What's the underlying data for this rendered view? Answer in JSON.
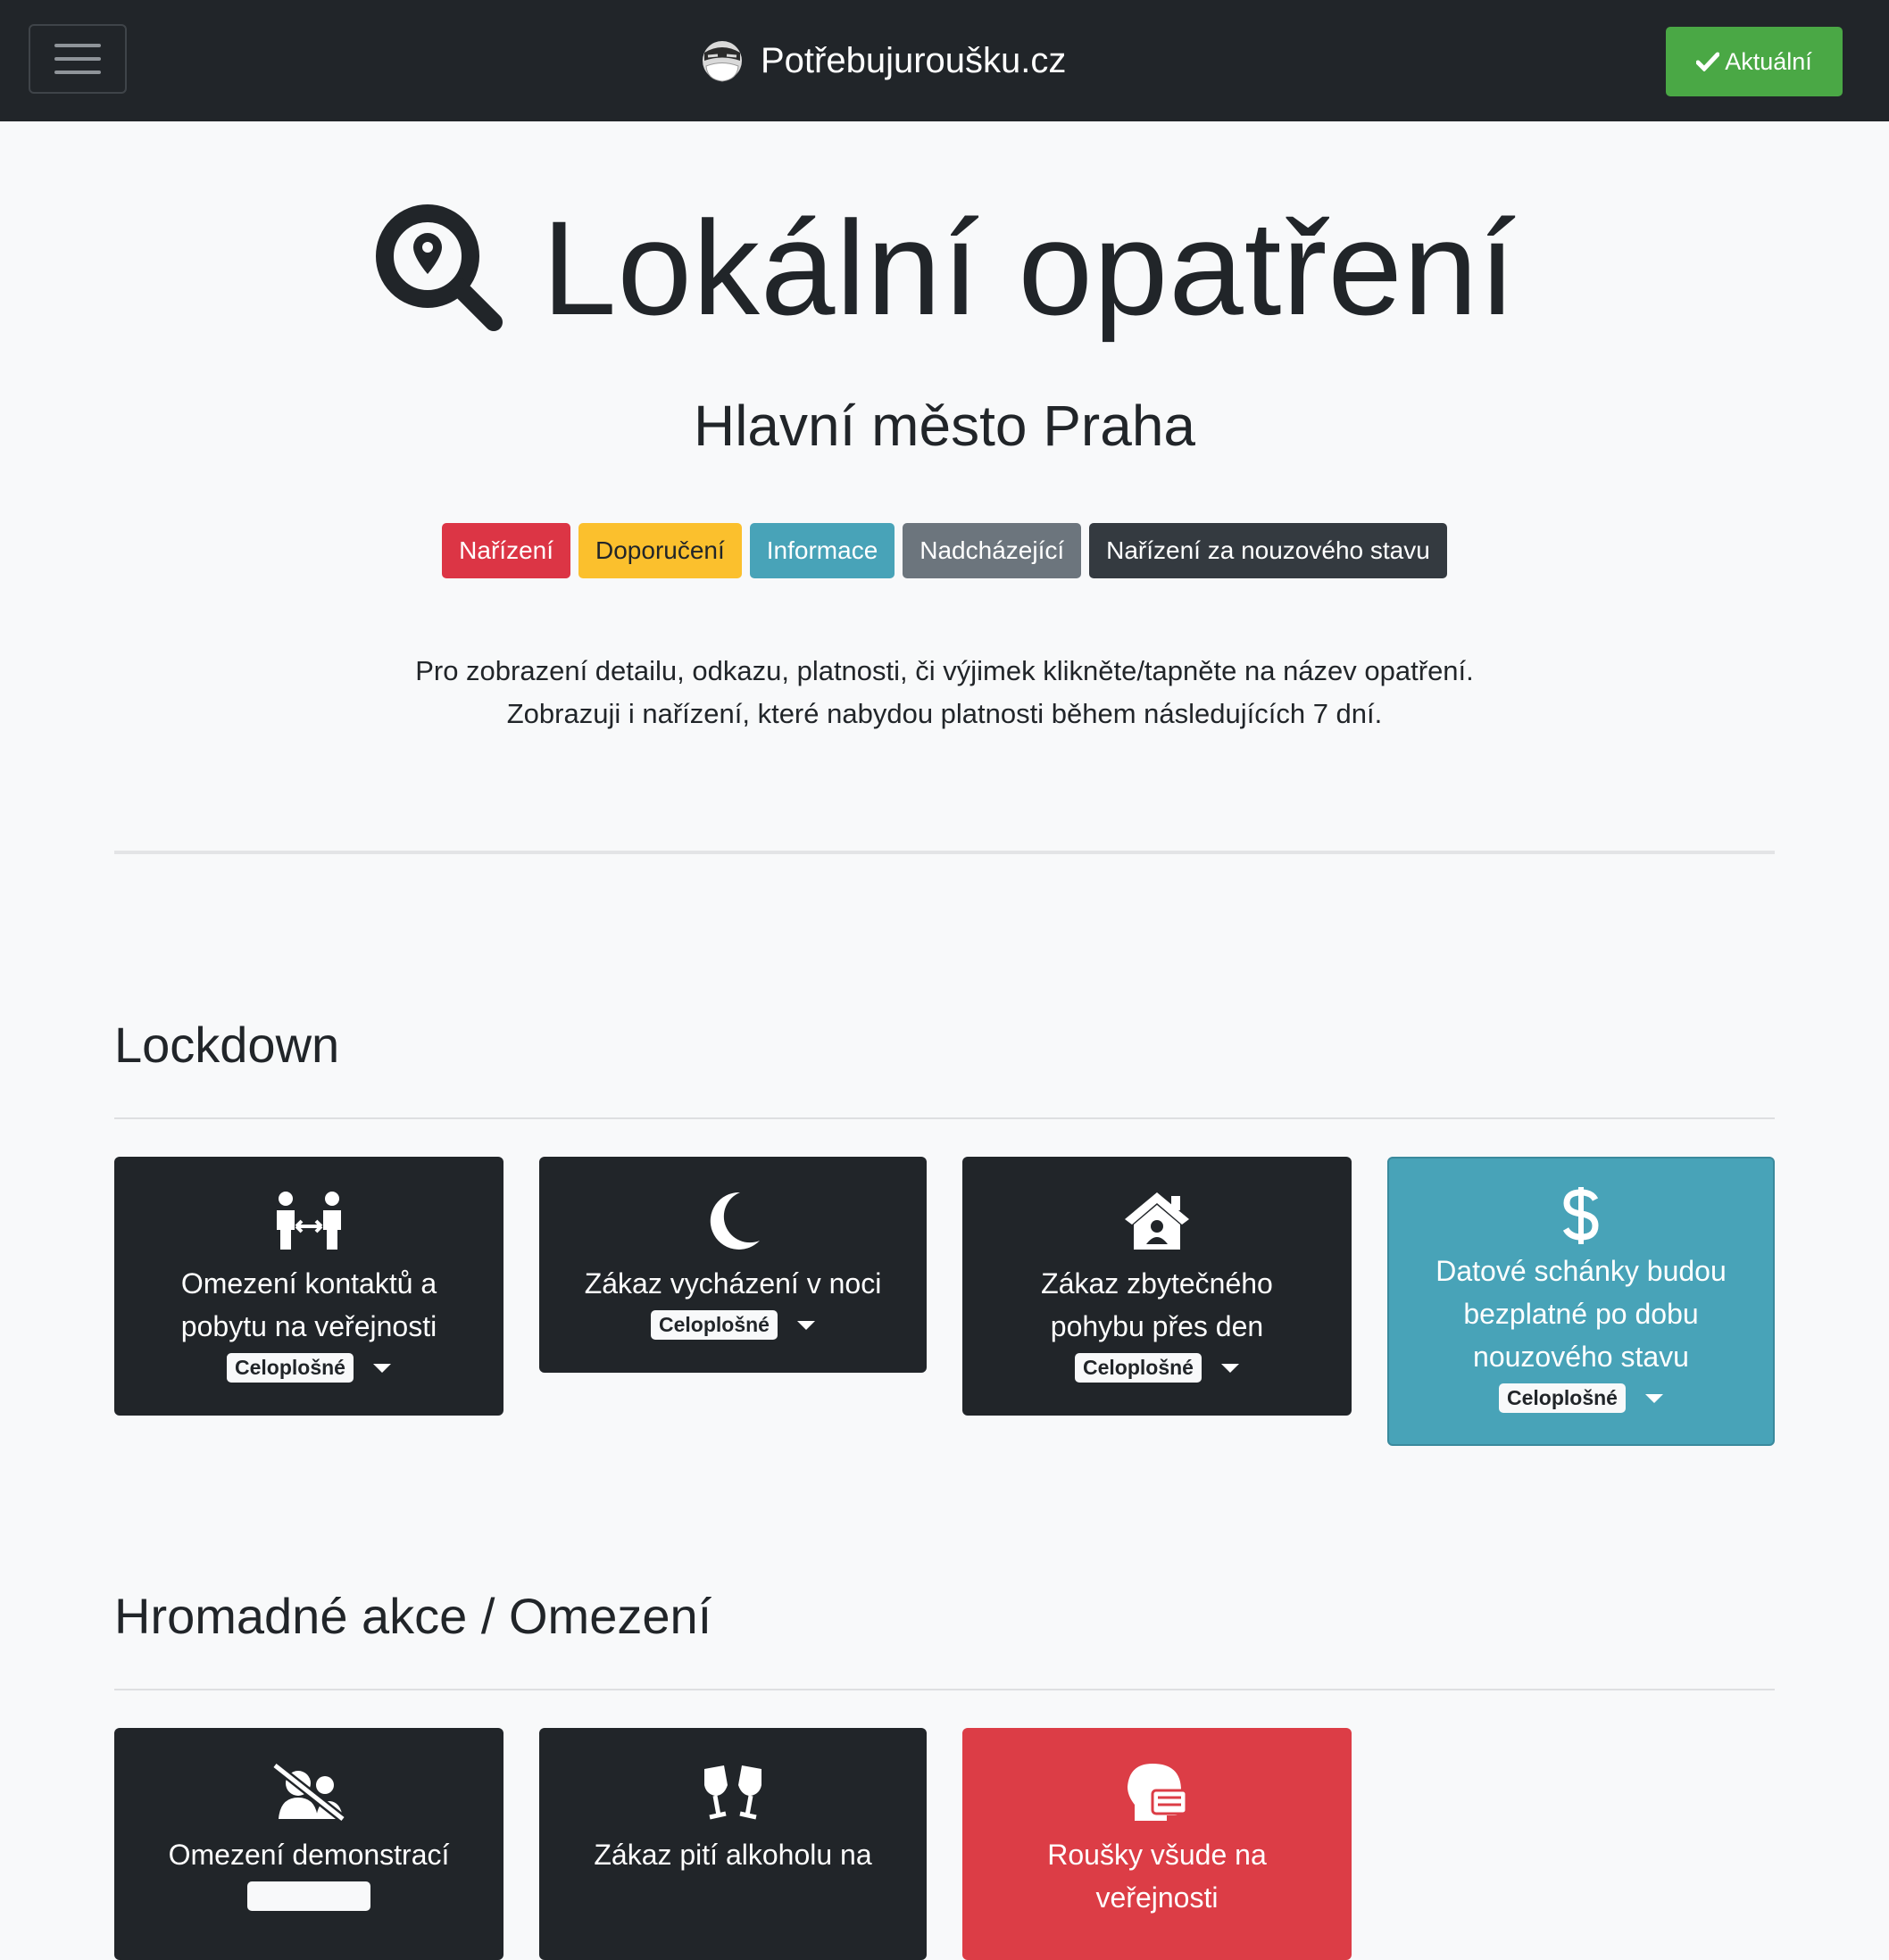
{
  "navbar": {
    "brand": "Potřebujuroušku.cz",
    "current_button": "Aktuální"
  },
  "hero": {
    "title": "Lokální opatření",
    "region": "Hlavní město Praha"
  },
  "legend": [
    {
      "label": "Nařízení",
      "bg": "#dc3545",
      "fg": "#ffffff"
    },
    {
      "label": "Doporučení",
      "bg": "#fbc02d",
      "fg": "#212529"
    },
    {
      "label": "Informace",
      "bg": "#48a3b8",
      "fg": "#ffffff"
    },
    {
      "label": "Nadcházející",
      "bg": "#6c757d",
      "fg": "#ffffff"
    },
    {
      "label": "Nařízení za nouzového stavu",
      "bg": "#343a40",
      "fg": "#ffffff"
    }
  ],
  "intro": {
    "line1": "Pro zobrazení detailu, odkazu, platnosti, či výjimek klikněte/tapněte na název opatření.",
    "line2": "Zobrazuji i nařízení, které nabydou platnosti během následujících 7 dní."
  },
  "sections": [
    {
      "title": "Lockdown",
      "cards": [
        {
          "title_lines": [
            "Omezení kontaktů a",
            "pobytu na veřejnosti"
          ],
          "tag": "Celoplošné",
          "icon": "people-distance-icon",
          "style": "dark"
        },
        {
          "title_lines": [
            "Zákaz vycházení v noci"
          ],
          "tag": "Celoplošné",
          "icon": "moon-icon",
          "style": "dark"
        },
        {
          "title_lines": [
            "Zákaz zbytečného",
            "pohybu přes den"
          ],
          "tag": "Celoplošné",
          "icon": "house-user-icon",
          "style": "dark"
        },
        {
          "title_lines": [
            "Datové schánky budou",
            "bezplatné po dobu",
            "nouzového stavu"
          ],
          "tag": "Celoplošné",
          "icon": "dollar-icon",
          "style": "info"
        }
      ]
    },
    {
      "title": "Hromadné akce / Omezení",
      "cards": [
        {
          "title_lines": [
            "Omezení demonstrací"
          ],
          "icon": "users-slash-icon",
          "style": "dark"
        },
        {
          "title_lines": [
            "Zákaz pití alkoholu na"
          ],
          "icon": "glass-cheers-icon",
          "style": "dark"
        },
        {
          "title_lines": [
            "Roušky všude na",
            "veřejnosti"
          ],
          "icon": "head-mask-icon",
          "style": "red"
        }
      ]
    }
  ],
  "colors": {
    "navbar": "#212529",
    "current_button": "#4aa845",
    "page_bg": "#f8f9fa"
  }
}
